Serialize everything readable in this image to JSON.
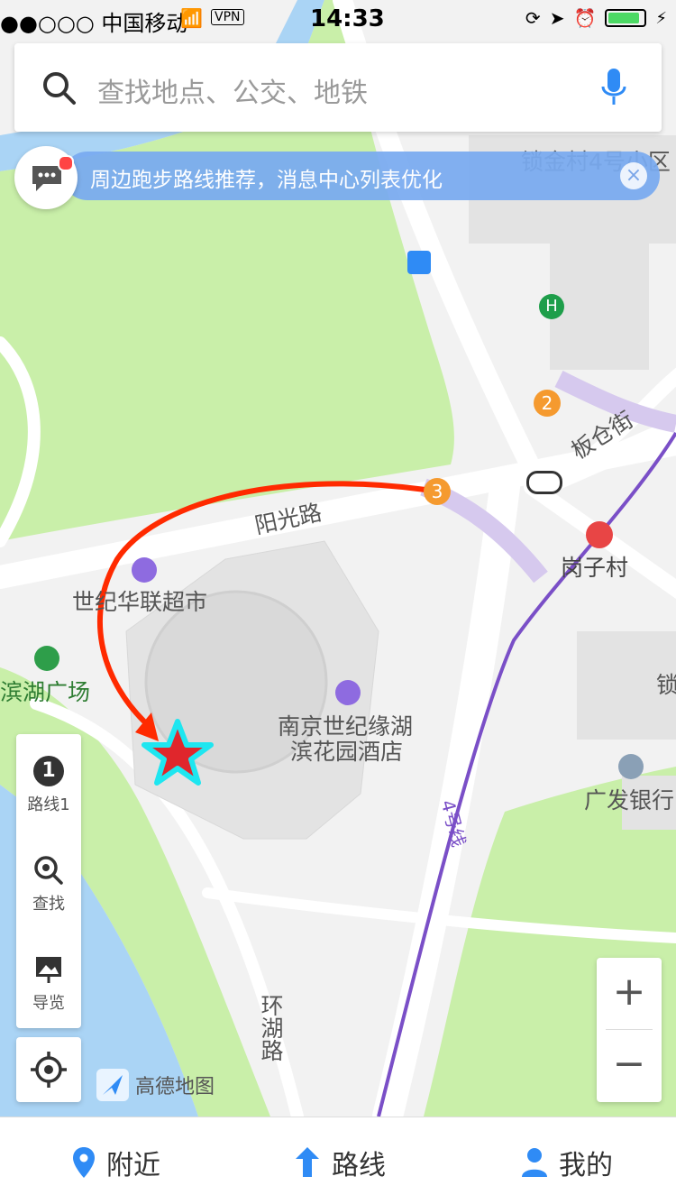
{
  "status_bar": {
    "carrier": "●●○○○ 中国移动",
    "vpn": "VPN",
    "time": "14:33"
  },
  "search": {
    "placeholder": "查找地点、公交、地铁"
  },
  "notice": {
    "text": "周边跑步路线推荐，消息中心列表优化",
    "close_glyph": "×"
  },
  "map_labels": {
    "suojin_community": "锁金村4号小区",
    "bancang_street": "板仓街",
    "yangguang_road": "阳光路",
    "gangzi_village": "岗子村",
    "century_hualian": "世纪华联超市",
    "binhu_square": "滨湖广场",
    "hotel_line1": "南京世纪缘湖",
    "hotel_line2": "滨花园酒店",
    "guangfa_bank": "广发银行",
    "metro_line4": "4号线",
    "huanhu_road": "环湖路",
    "edge_suo": "锁",
    "badge_2": "2",
    "badge_3": "3"
  },
  "tools": {
    "route1_number": "1",
    "route1_label": "路线1",
    "search_label": "查找",
    "guide_label": "导览"
  },
  "zoom": {
    "plus": "+",
    "minus": "−"
  },
  "brand": "高德地图",
  "tabs": {
    "nearby": "附近",
    "route": "路线",
    "mine": "我的"
  },
  "colors": {
    "water": "#aad4f5",
    "park": "#c9efa9",
    "road": "#ffffff",
    "metro_line": "#7a4fc7",
    "annotation_arrow": "#ff2a00",
    "marker_star_fill": "#e0262c",
    "marker_star_outline": "#1ee6f0",
    "accent_blue": "#2f8bf5"
  }
}
